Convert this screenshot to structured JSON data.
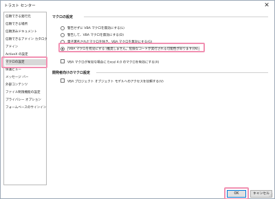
{
  "window": {
    "title": "トラスト センター",
    "close_glyph": "✕"
  },
  "sidebar": {
    "items": [
      {
        "label": "信頼できる発行元",
        "selected": false
      },
      {
        "label": "信頼できる場所",
        "selected": false
      },
      {
        "label": "信頼済みドキュメント",
        "selected": false
      },
      {
        "label": "信頼できるアドイン カタログ",
        "selected": false
      },
      {
        "label": "アドイン",
        "selected": false
      },
      {
        "label": "ActiveX の設定",
        "selected": false
      },
      {
        "label": "マクロの設定",
        "selected": true
      },
      {
        "label": "保護ビュー",
        "selected": false
      },
      {
        "label": "メッセージ バー",
        "selected": false
      },
      {
        "label": "外部コンテンツ",
        "selected": false
      },
      {
        "label": "ファイル制限機能の設定",
        "selected": false
      },
      {
        "label": "プライバシー オプション",
        "selected": false
      },
      {
        "label": "フォームベースのサインイン",
        "selected": false
      }
    ]
  },
  "macro_settings": {
    "heading": "マクロの設定",
    "options": [
      {
        "label": "警告せずに VBA マクロを無効にする(L)",
        "checked": false
      },
      {
        "label": "警告して、VBA マクロを無効にする(D)",
        "checked": false
      },
      {
        "label": "電子署名されたマクロを除き、VBA マクロを無効にする(G)",
        "checked": false
      },
      {
        "label": "VBA マクロを有効にする (推奨しません。危険なコードが実行される可能性があります)(N)",
        "checked": true
      }
    ],
    "excel4_checkbox": {
      "label": "VBA マクロが有効な場合に Excel 4.0 のマクロを有効にする(X)",
      "checked": false
    }
  },
  "developer_settings": {
    "heading": "開発者向けのマクロ設定",
    "checkbox": {
      "label": "VBA プロジェクト オブジェクト モデルへのアクセスを信頼する(V)",
      "checked": false
    }
  },
  "buttons": {
    "ok": "OK",
    "cancel": "キャンセル"
  },
  "colors": {
    "highlight": "#f18fb1",
    "selected_bg": "#d8d8d8",
    "ok_border": "#0078d7"
  }
}
